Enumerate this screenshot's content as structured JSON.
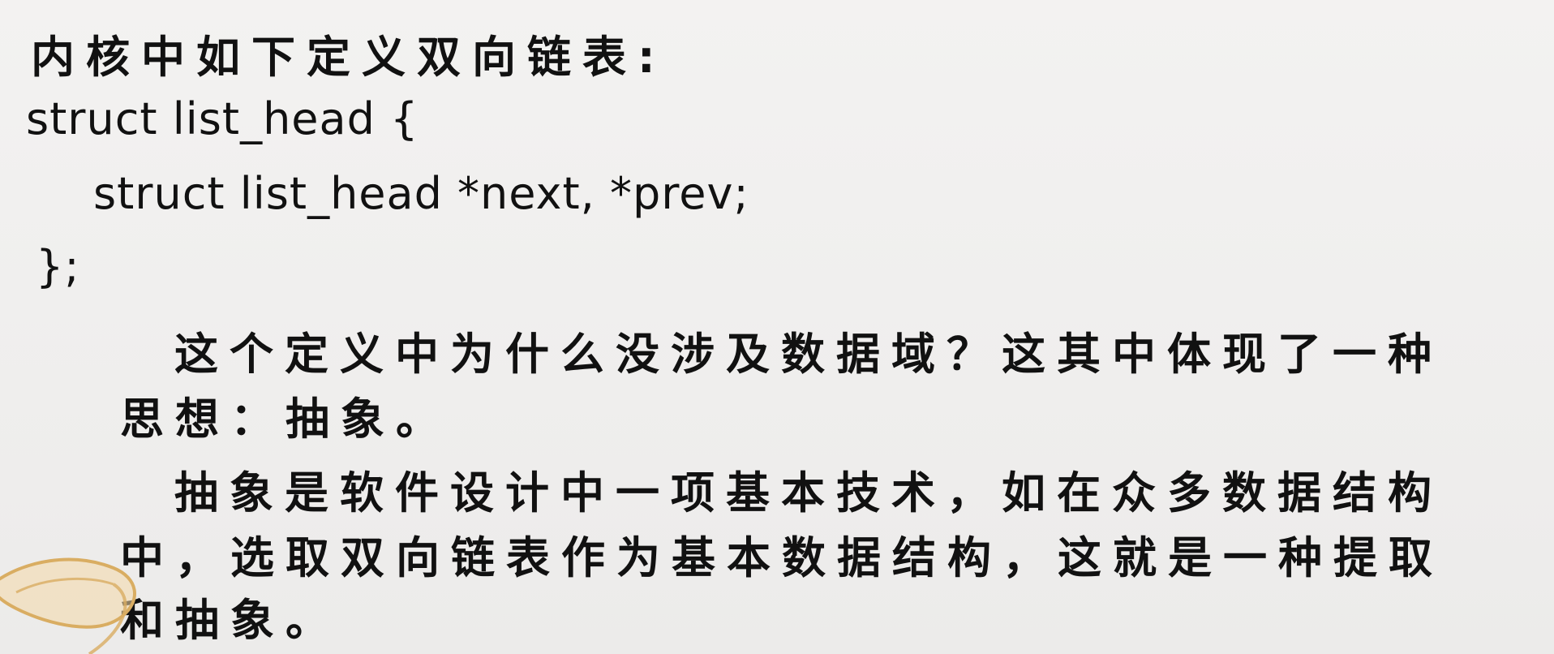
{
  "slide": {
    "heading": "内核中如下定义双向链表:",
    "code_lines": [
      "struct list_head {",
      "struct list_head *next, *prev;",
      "};"
    ],
    "paragraph1_lines": [
      "这个定义中为什么没涉及数据域？这其中体现了一种",
      "思想：抽象。"
    ],
    "paragraph2_lines": [
      "抽象是软件设计中一项基本技术，如在众多数据结构",
      "中，选取双向链表作为基本数据结构，这就是一种提取",
      "和抽象。"
    ]
  },
  "colors": {
    "background": "#f0efee",
    "text": "#111111",
    "decor_fill": "#f4d9a8",
    "decor_stroke": "#d9ad62"
  },
  "icons": [
    "slide-corner-ribbon-decoration"
  ]
}
